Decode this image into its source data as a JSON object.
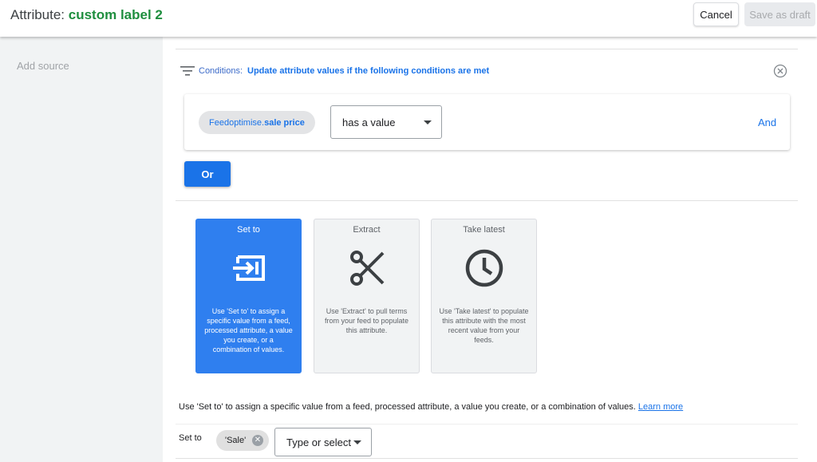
{
  "header": {
    "title_prefix": "Attribute: ",
    "title_name": "custom label 2",
    "cancel_label": "Cancel",
    "save_draft_label": "Save as draft"
  },
  "sidebar": {
    "add_source_label": "Add source"
  },
  "conditions": {
    "label": "Conditions: ",
    "description": "Update attribute values if the following conditions are met",
    "chip_prefix": "Feedoptimise.",
    "chip_field": "sale price",
    "operator": "has a value",
    "and_label": "And",
    "or_label": "Or"
  },
  "actions": [
    {
      "title": "Set to",
      "icon": "set-to-arrow-icon",
      "description": "Use 'Set to' to assign a specific value from a feed, processed attribute, a value you create, or a combination of values.",
      "selected": true
    },
    {
      "title": "Extract",
      "icon": "scissors-icon",
      "description": "Use 'Extract' to pull terms from your feed to populate this attribute.",
      "selected": false
    },
    {
      "title": "Take latest",
      "icon": "clock-icon",
      "description": "Use 'Take latest' to populate this attribute with the most recent value from your feeds.",
      "selected": false
    }
  ],
  "footer": {
    "help_text": "Use 'Set to' to assign a specific value from a feed, processed attribute, a value you create, or a combination of values. ",
    "learn_more": "Learn more",
    "set_to_label": "Set to",
    "value_chip": "'Sale'",
    "type_select_placeholder": "Type or select"
  },
  "colors": {
    "accent": "#1a73e8",
    "title_green": "#1e8e3e",
    "active_card": "#2f7fef"
  }
}
